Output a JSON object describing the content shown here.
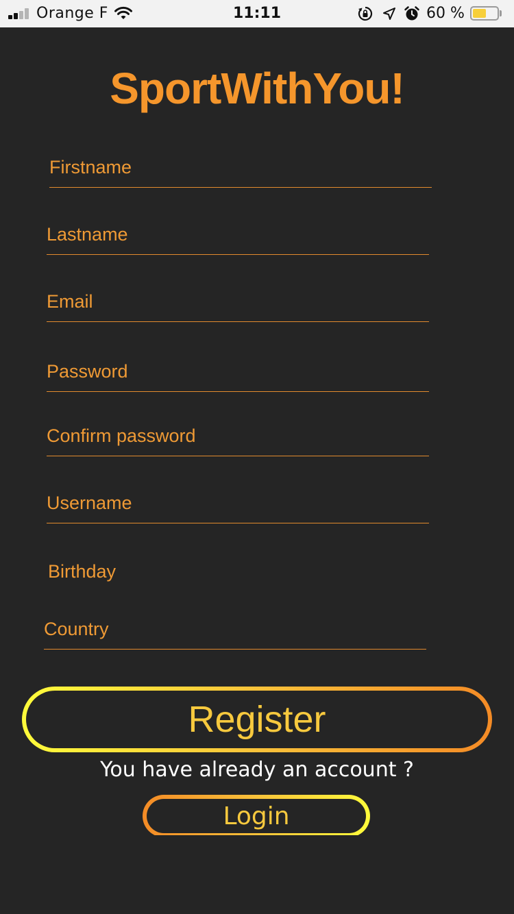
{
  "status_bar": {
    "carrier": "Orange F",
    "time": "11:11",
    "battery_percent": "60 %",
    "battery_level": 0.6,
    "icons": [
      "signal-icon",
      "wifi-icon",
      "rotation-lock-icon",
      "location-icon",
      "alarm-icon",
      "battery-icon"
    ]
  },
  "app": {
    "title": "SportWithYou!"
  },
  "form": {
    "firstname": {
      "placeholder": "Firstname",
      "value": ""
    },
    "lastname": {
      "placeholder": "Lastname",
      "value": ""
    },
    "email": {
      "placeholder": "Email",
      "value": ""
    },
    "password": {
      "placeholder": "Password",
      "value": ""
    },
    "confirm_password": {
      "placeholder": "Confirm password",
      "value": ""
    },
    "username": {
      "placeholder": "Username",
      "value": ""
    },
    "birthday": {
      "placeholder": "Birthday",
      "value": ""
    },
    "country": {
      "placeholder": "Country",
      "value": ""
    }
  },
  "actions": {
    "register_label": "Register",
    "already_account_text": "You have already an account ?",
    "login_label": "Login"
  },
  "colors": {
    "background": "#252525",
    "accent_orange": "#f5962c",
    "accent_yellow": "#f7c93e",
    "gradient_start": "#fffb3b",
    "gradient_end": "#f48b26",
    "text_white": "#ffffff"
  }
}
